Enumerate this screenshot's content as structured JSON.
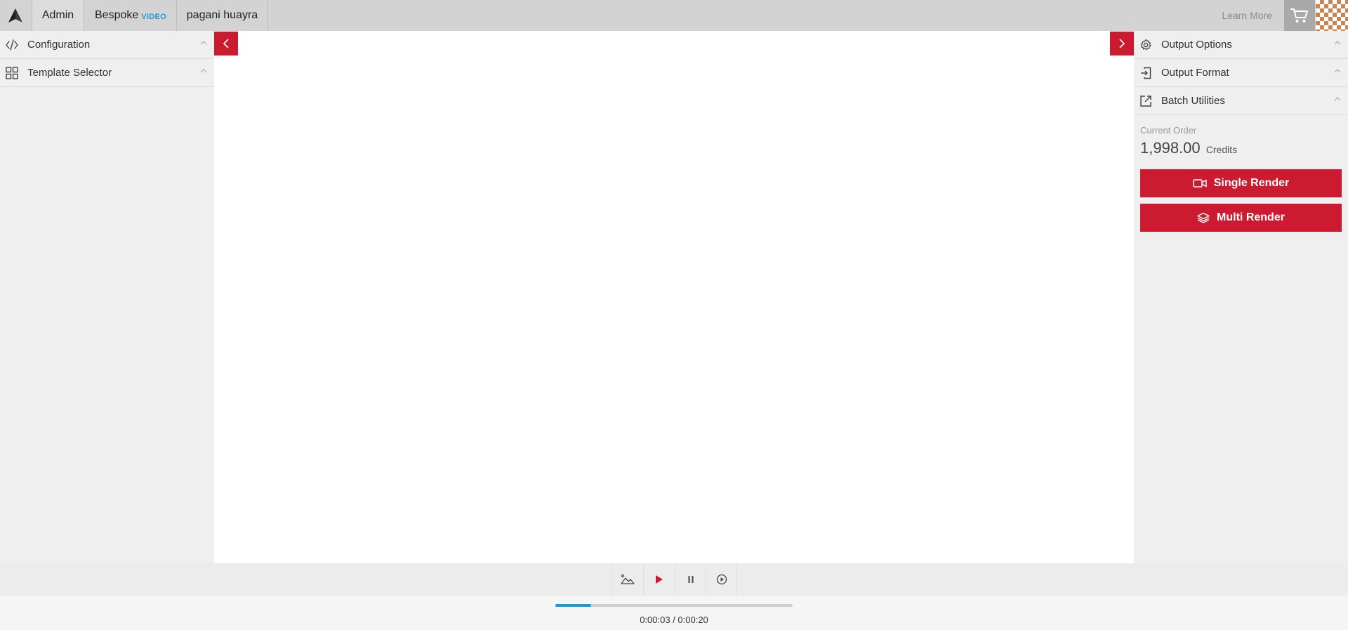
{
  "nav": {
    "admin": "Admin",
    "bespoke": "Bespoke",
    "bespoke_tag": "VIDEO",
    "project": "pagani huayra",
    "learn_more": "Learn More"
  },
  "left_panel": {
    "items": [
      {
        "label": "Configuration",
        "icon": "code-icon"
      },
      {
        "label": "Template Selector",
        "icon": "grid-icon"
      }
    ]
  },
  "right_panel": {
    "items": [
      {
        "label": "Output Options",
        "icon": "gear-icon"
      },
      {
        "label": "Output Format",
        "icon": "import-icon"
      },
      {
        "label": "Batch Utilities",
        "icon": "external-link-icon"
      }
    ],
    "order_label": "Current Order",
    "order_amount": "1,998.00",
    "order_unit": "Credits",
    "single_render": "Single Render",
    "multi_render": "Multi Render"
  },
  "player": {
    "time": "0:00:03 / 0:00:20",
    "progress_fraction": 0.15
  },
  "colors": {
    "accent": "#cc1a30",
    "progress": "#1a9ad6",
    "video_tag": "#1e9bd7"
  }
}
